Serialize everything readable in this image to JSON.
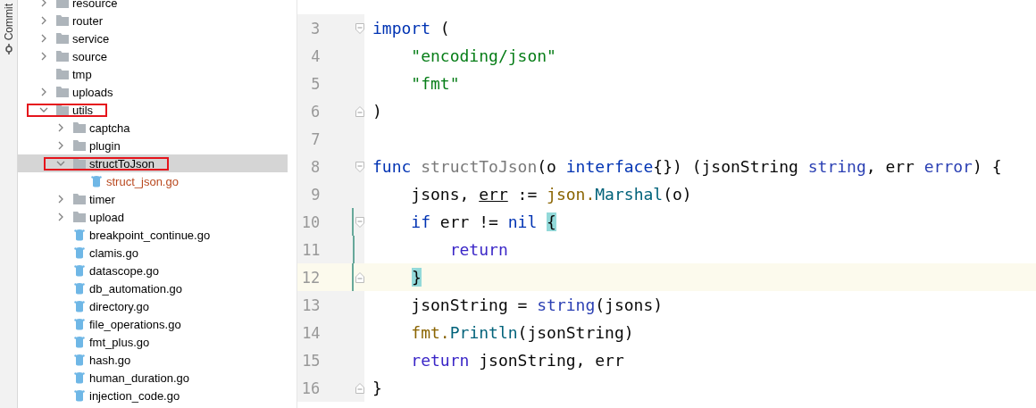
{
  "side_strip": {
    "label": "Commit"
  },
  "project_tree": [
    {
      "label": "resource",
      "kind": "folder",
      "expanded": false,
      "selected": false
    },
    {
      "label": "router",
      "kind": "folder",
      "expanded": false,
      "selected": false
    },
    {
      "label": "service",
      "kind": "folder",
      "expanded": false,
      "selected": false
    },
    {
      "label": "source",
      "kind": "folder",
      "expanded": false,
      "selected": false
    },
    {
      "label": "tmp",
      "kind": "folder",
      "selected": false
    },
    {
      "label": "uploads",
      "kind": "folder",
      "expanded": false,
      "selected": false
    },
    {
      "label": "utils",
      "kind": "folder",
      "expanded": true,
      "selected": false,
      "annotated": true,
      "children": [
        {
          "label": "captcha",
          "kind": "folder",
          "expanded": false,
          "selected": false
        },
        {
          "label": "plugin",
          "kind": "folder",
          "expanded": false,
          "selected": false
        },
        {
          "label": "structToJson",
          "kind": "folder",
          "expanded": true,
          "selected": true,
          "annotated": true,
          "children": [
            {
              "label": "struct_json.go",
              "kind": "file",
              "unversioned": true,
              "selected": false
            }
          ]
        },
        {
          "label": "timer",
          "kind": "folder",
          "expanded": false,
          "selected": false
        },
        {
          "label": "upload",
          "kind": "folder",
          "expanded": false,
          "selected": false
        },
        {
          "label": "breakpoint_continue.go",
          "kind": "file",
          "unversioned": false,
          "selected": false
        },
        {
          "label": "clamis.go",
          "kind": "file",
          "unversioned": false,
          "selected": false
        },
        {
          "label": "datascope.go",
          "kind": "file",
          "unversioned": false,
          "selected": false
        },
        {
          "label": "db_automation.go",
          "kind": "file",
          "unversioned": false,
          "selected": false
        },
        {
          "label": "directory.go",
          "kind": "file",
          "unversioned": false,
          "selected": false
        },
        {
          "label": "file_operations.go",
          "kind": "file",
          "unversioned": false,
          "selected": false
        },
        {
          "label": "fmt_plus.go",
          "kind": "file",
          "unversioned": false,
          "selected": false
        },
        {
          "label": "hash.go",
          "kind": "file",
          "unversioned": false,
          "selected": false
        },
        {
          "label": "human_duration.go",
          "kind": "file",
          "unversioned": false,
          "selected": false
        },
        {
          "label": "injection_code.go",
          "kind": "file",
          "unversioned": false,
          "selected": false
        }
      ]
    }
  ],
  "editor": {
    "lines": [
      {
        "number": "3",
        "current": false,
        "changed": false,
        "fold_start": true,
        "fold_end": false,
        "tokens": [
          {
            "t": "import",
            "kind": "kw"
          },
          {
            "t": " (",
            "kind": "plain"
          }
        ]
      },
      {
        "number": "4",
        "current": false,
        "changed": false,
        "fold_start": false,
        "fold_end": false,
        "tokens": [
          {
            "t": "    \"encoding/json\"",
            "kind": "str"
          }
        ]
      },
      {
        "number": "5",
        "current": false,
        "changed": false,
        "fold_start": false,
        "fold_end": false,
        "tokens": [
          {
            "t": "    \"fmt\"",
            "kind": "str"
          }
        ]
      },
      {
        "number": "6",
        "current": false,
        "changed": false,
        "fold_start": false,
        "fold_end": true,
        "tokens": [
          {
            "t": ")",
            "kind": "plain"
          }
        ]
      },
      {
        "number": "7",
        "current": false,
        "changed": false,
        "fold_start": false,
        "fold_end": false
      },
      {
        "number": "8",
        "current": false,
        "changed": false,
        "fold_start": true,
        "fold_end": false,
        "tokens": [
          {
            "t": "func",
            "kind": "kw"
          },
          {
            "t": " structToJson",
            "kind": "unused"
          },
          {
            "t": "(o ",
            "kind": "plain"
          },
          {
            "t": "interface",
            "kind": "kw"
          },
          {
            "t": "{}) (jsonString ",
            "kind": "plain"
          },
          {
            "t": "string",
            "kind": "type"
          },
          {
            "t": ", err ",
            "kind": "plain"
          },
          {
            "t": "error",
            "kind": "type"
          },
          {
            "t": ") {",
            "kind": "plain"
          }
        ]
      },
      {
        "number": "9",
        "current": false,
        "changed": false,
        "fold_start": false,
        "fold_end": false,
        "tokens": [
          {
            "t": "    jsons, ",
            "kind": "plain"
          },
          {
            "t": "err",
            "kind": "reassigned"
          },
          {
            "t": " := ",
            "kind": "plain"
          },
          {
            "t": "json.",
            "kind": "pkg"
          },
          {
            "t": "Marshal",
            "kind": "call"
          },
          {
            "t": "(o)",
            "kind": "plain"
          }
        ]
      },
      {
        "number": "10",
        "current": false,
        "changed": true,
        "fold_start": true,
        "fold_end": false,
        "tokens": [
          {
            "t": "    if",
            "kind": "kw"
          },
          {
            "t": " err != ",
            "kind": "plain"
          },
          {
            "t": "nil ",
            "kind": "kw"
          },
          {
            "t": "{",
            "kind": "brace"
          }
        ]
      },
      {
        "number": "11",
        "current": false,
        "changed": true,
        "fold_start": false,
        "fold_end": false,
        "tokens": [
          {
            "t": "        return",
            "kind": "kw2"
          }
        ]
      },
      {
        "number": "12",
        "current": true,
        "changed": true,
        "fold_start": false,
        "fold_end": true,
        "indented": true,
        "tokens": [
          {
            "t": "}",
            "kind": "brace"
          }
        ]
      },
      {
        "number": "13",
        "current": false,
        "changed": false,
        "fold_start": false,
        "fold_end": false,
        "tokens": [
          {
            "t": "    jsonString = ",
            "kind": "plain"
          },
          {
            "t": "string",
            "kind": "type"
          },
          {
            "t": "(jsons)",
            "kind": "plain"
          }
        ]
      },
      {
        "number": "14",
        "current": false,
        "changed": false,
        "fold_start": false,
        "fold_end": false,
        "tokens": [
          {
            "t": "    fmt.",
            "kind": "pkg"
          },
          {
            "t": "Println",
            "kind": "call"
          },
          {
            "t": "(jsonString)",
            "kind": "plain"
          }
        ]
      },
      {
        "number": "15",
        "current": false,
        "changed": false,
        "fold_start": false,
        "fold_end": false,
        "tokens": [
          {
            "t": "    return",
            "kind": "kw2"
          },
          {
            "t": " jsonString, err",
            "kind": "plain"
          }
        ]
      },
      {
        "number": "16",
        "current": false,
        "changed": false,
        "fold_start": false,
        "fold_end": true,
        "tokens": [
          {
            "t": "}",
            "kind": "plain"
          }
        ]
      }
    ]
  }
}
